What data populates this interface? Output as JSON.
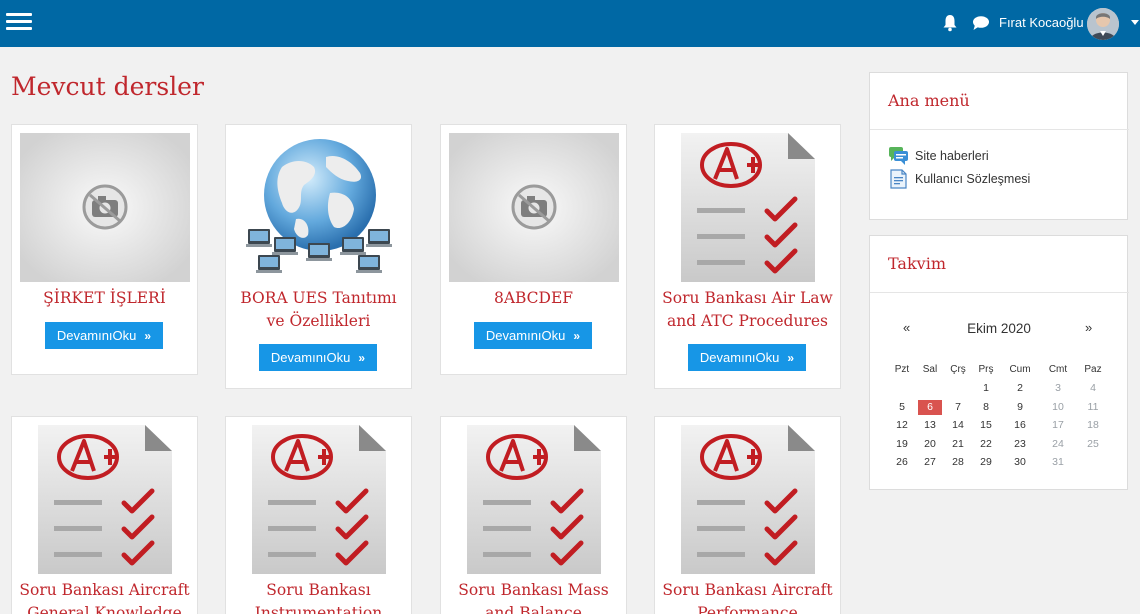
{
  "topbar": {
    "user_name": "Fırat Kocaoğlu",
    "menu_icon": "hamburger-icon",
    "notification_icon": "bell-icon",
    "message_icon": "chat-icon",
    "brand_color": "#0068a4"
  },
  "main": {
    "title": "Mevcut dersler",
    "more_label": "DevamınıOku",
    "courses": [
      {
        "name": "ŞİRKET İŞLERİ",
        "thumbnail": "no-image-camera-icon"
      },
      {
        "name": "BORA UES Tanıtımı ve Özellikleri",
        "thumbnail": "globe-network-image"
      },
      {
        "name": "8ABCDEF",
        "thumbnail": "no-image-camera-icon"
      },
      {
        "name": "Soru Bankası Air Law and ATC Procedures",
        "thumbnail": "exam-paper-icon"
      },
      {
        "name": "Soru Bankası Aircraft General Knowledge",
        "thumbnail": "exam-paper-icon"
      },
      {
        "name": "Soru Bankası Instrumentation",
        "thumbnail": "exam-paper-icon"
      },
      {
        "name": "Soru Bankası Mass and Balance",
        "thumbnail": "exam-paper-icon"
      },
      {
        "name": "Soru Bankası Aircraft Performance",
        "thumbnail": "exam-paper-icon"
      }
    ]
  },
  "main_menu": {
    "title": "Ana menü",
    "items": [
      {
        "label": "Site haberleri",
        "icon": "forum-icon"
      },
      {
        "label": "Kullanıcı Sözleşmesi",
        "icon": "document-icon"
      }
    ]
  },
  "calendar": {
    "title": "Takvim",
    "month": "Ekim 2020",
    "prev": "«",
    "next": "»",
    "weekdays": [
      "Pzt",
      "Sal",
      "Çrş",
      "Prş",
      "Cum",
      "Cmt",
      "Paz"
    ],
    "weeks": [
      [
        "",
        "",
        "",
        "1",
        "2",
        "3",
        "4"
      ],
      [
        "5",
        "6",
        "7",
        "8",
        "9",
        "10",
        "11"
      ],
      [
        "12",
        "13",
        "14",
        "15",
        "16",
        "17",
        "18"
      ],
      [
        "19",
        "20",
        "21",
        "22",
        "23",
        "24",
        "25"
      ],
      [
        "26",
        "27",
        "28",
        "29",
        "30",
        "31",
        ""
      ]
    ],
    "today": "6",
    "today_color": "#d9534f"
  }
}
